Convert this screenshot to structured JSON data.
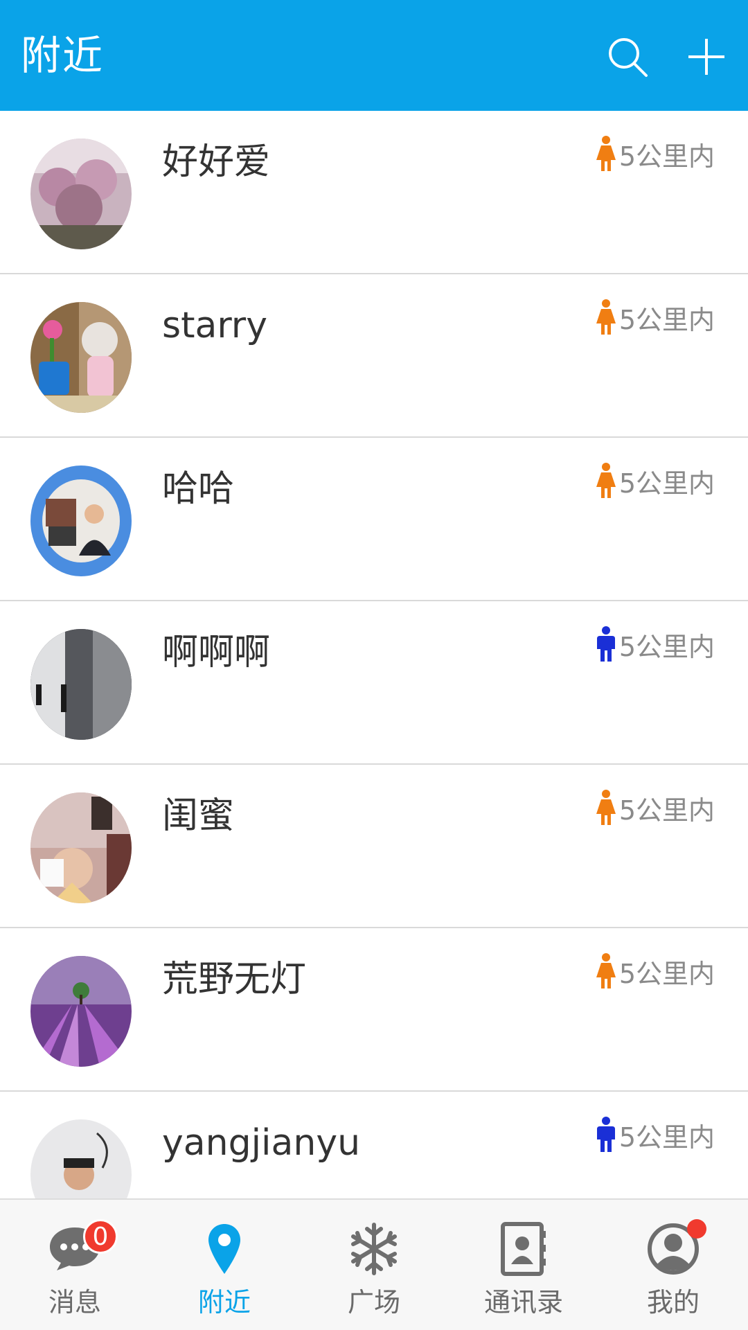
{
  "header": {
    "title": "附近",
    "search_icon": "search-icon",
    "add_icon": "plus-icon",
    "background_color": "#0aa3e8"
  },
  "nearby_list": [
    {
      "name": "好好爱",
      "gender": "female",
      "distance": "5公里内"
    },
    {
      "name": "starry",
      "gender": "female",
      "distance": "5公里内"
    },
    {
      "name": "哈哈",
      "gender": "female",
      "distance": "5公里内"
    },
    {
      "name": "啊啊啊",
      "gender": "male",
      "distance": "5公里内"
    },
    {
      "name": "闺蜜",
      "gender": "female",
      "distance": "5公里内"
    },
    {
      "name": "荒野无灯",
      "gender": "female",
      "distance": "5公里内"
    },
    {
      "name": "yangjianyu",
      "gender": "male",
      "distance": "5公里内"
    }
  ],
  "gender_colors": {
    "female": "#f07e12",
    "male": "#1a2fd6"
  },
  "bottom_nav": {
    "items": [
      {
        "label": "消息",
        "icon": "chat-bubble-icon",
        "badge": "0"
      },
      {
        "label": "附近",
        "icon": "location-pin-icon"
      },
      {
        "label": "广场",
        "icon": "snowflake-icon"
      },
      {
        "label": "通讯录",
        "icon": "contacts-book-icon"
      },
      {
        "label": "我的",
        "icon": "profile-icon"
      }
    ],
    "active_index": 1,
    "active_color": "#0aa3e8"
  }
}
